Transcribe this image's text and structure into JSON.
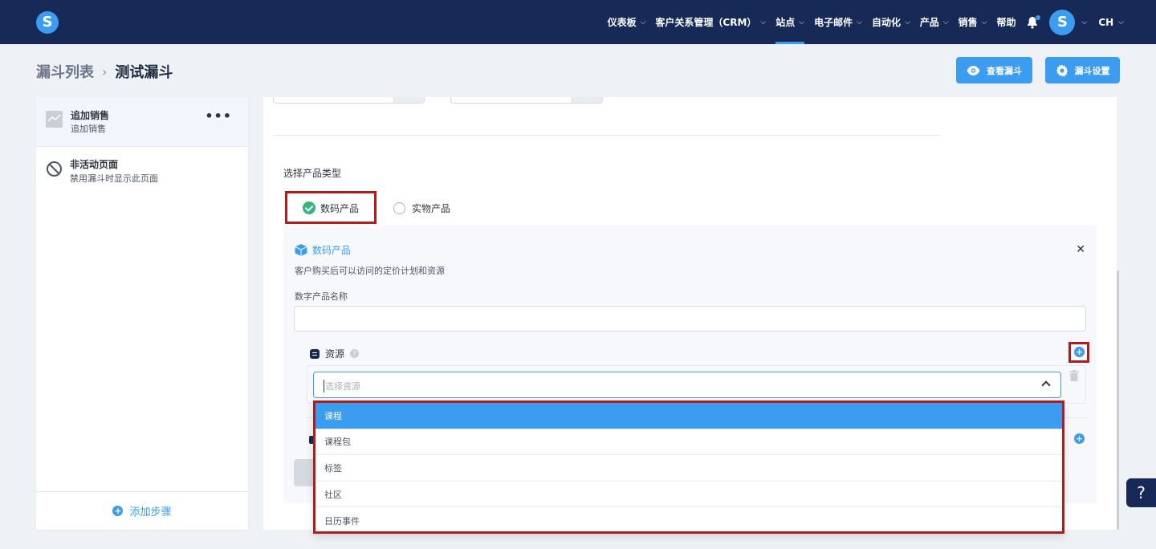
{
  "nav": {
    "logo": "S",
    "items": [
      {
        "label": "仪表板",
        "chevron": true,
        "active": false
      },
      {
        "label": "客户关系管理（CRM）",
        "chevron": true,
        "active": false
      },
      {
        "label": "站点",
        "chevron": true,
        "active": true
      },
      {
        "label": "电子邮件",
        "chevron": true,
        "active": false
      },
      {
        "label": "自动化",
        "chevron": true,
        "active": false
      },
      {
        "label": "产品",
        "chevron": true,
        "active": false
      },
      {
        "label": "销售",
        "chevron": true,
        "active": false
      },
      {
        "label": "帮助",
        "chevron": false,
        "active": false
      }
    ],
    "avatar": "S",
    "lang": "CH"
  },
  "breadcrumb": {
    "parent": "漏斗列表",
    "current": "测试漏斗"
  },
  "header_buttons": {
    "view": "查看漏斗",
    "settings": "漏斗设置"
  },
  "steps": [
    {
      "title": "追加销售",
      "subtitle": "追加销售"
    },
    {
      "title": "非活动页面",
      "subtitle": "禁用漏斗时显示此页面"
    }
  ],
  "add_step": "添加步骤",
  "product_type": {
    "title": "选择产品类型",
    "options": [
      {
        "label": "数码产品",
        "selected": true
      },
      {
        "label": "实物产品",
        "selected": false
      }
    ]
  },
  "digital_card": {
    "title": "数码产品",
    "description": "客户购买后可以访问的定价计划和资源",
    "name_label": "数字产品名称",
    "name_value": "",
    "resources_label": "资源",
    "select_placeholder": "选择资源"
  },
  "dropdown": {
    "options": [
      "课程",
      "课程包",
      "标签",
      "社区",
      "日历事件"
    ],
    "selected_index": 0
  },
  "help_fab": "?",
  "colors": {
    "nav_bg": "#172a57",
    "accent": "#3b9cf0",
    "highlight": "#b01c1c",
    "check": "#36b37e"
  }
}
